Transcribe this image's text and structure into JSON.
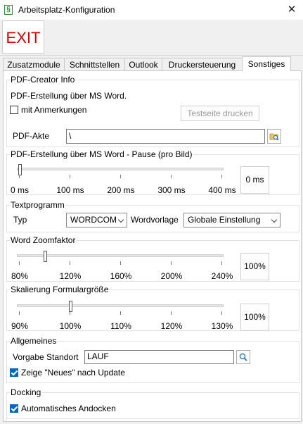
{
  "window": {
    "title": "Arbeitsplatz-Konfiguration",
    "close_glyph": "✕",
    "app_icon_glyph": "§"
  },
  "toolbar": {
    "exit_label": "EXIT"
  },
  "tabs": [
    {
      "label": "Zusatzmodule",
      "active": false
    },
    {
      "label": "Schnittstellen",
      "active": false
    },
    {
      "label": "Outlook",
      "active": false
    },
    {
      "label": "Druckersteuerung",
      "active": false
    },
    {
      "label": "Sonstiges",
      "active": true
    }
  ],
  "pdf_creator": {
    "group_title": "PDF-Creator Info",
    "info_text": "PDF-Erstellung über MS Word.",
    "annotations_label": "mit Anmerkungen",
    "annotations_checked": false,
    "test_print_label": "Testseite drucken",
    "akte_label": "PDF-Akte",
    "akte_value": "\\"
  },
  "pause": {
    "group_title": "PDF-Erstellung über MS Word - Pause (pro Bild)",
    "ticks": [
      "0 ms",
      "100 ms",
      "200 ms",
      "300 ms",
      "400 ms"
    ],
    "value": 0,
    "value_label": "0 ms"
  },
  "textprogramm": {
    "group_title": "Textprogramm",
    "typ_label": "Typ",
    "typ_value": "WORDCOM",
    "wordvorlage_label": "Wordvorlage",
    "wordvorlage_value": "Globale Einstellung"
  },
  "zoom": {
    "group_title": "Word Zoomfaktor",
    "ticks": [
      "80%",
      "120%",
      "160%",
      "200%",
      "240%"
    ],
    "value": 100,
    "value_label": "100%"
  },
  "scaling": {
    "group_title": "Skalierung Formulargröße",
    "ticks": [
      "90%",
      "100%",
      "110%",
      "120%",
      "130%"
    ],
    "value": 100,
    "value_label": "100%"
  },
  "allgemeines": {
    "group_title": "Allgemeines",
    "standort_label": "Vorgabe Standort",
    "standort_value": "LAUF",
    "news_label": "Zeige \"Neues\" nach Update",
    "news_checked": true
  },
  "docking": {
    "group_title": "Docking",
    "auto_dock_label": "Automatisches Andocken",
    "auto_dock_checked": true
  }
}
